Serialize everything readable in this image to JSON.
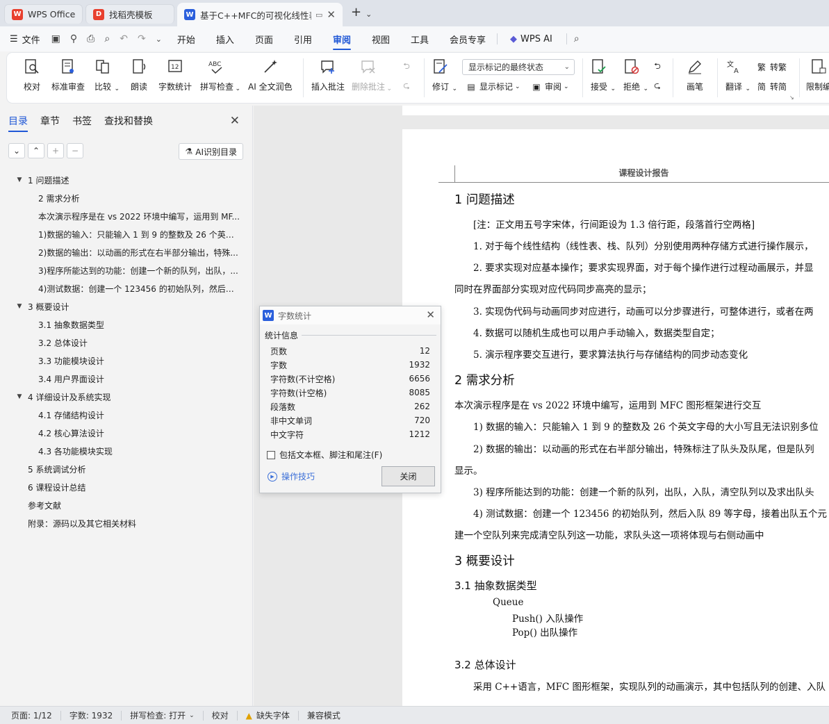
{
  "tabs": [
    {
      "label": "WPS Office",
      "state": "inactive",
      "color": "#e8402f"
    },
    {
      "label": "找稻壳模板",
      "state": "inactive",
      "color": "#e8402f"
    },
    {
      "label": "基于C++MFC的可视化线性表",
      "state": "active",
      "color": "#2b5fdc"
    }
  ],
  "menu": {
    "file": "文件",
    "items": [
      "开始",
      "插入",
      "页面",
      "引用",
      "审阅",
      "视图",
      "工具",
      "会员专享"
    ],
    "active": "审阅",
    "wps_ai": "WPS AI"
  },
  "ribbon": {
    "proofread": "校对",
    "standard_review": "标准审查",
    "compare": "比较",
    "read_aloud": "朗读",
    "word_count": "字数统计",
    "spell_check": "拼写检查",
    "ai_polish": "AI 全文润色",
    "insert_comment": "插入批注",
    "delete_comment": "删除批注",
    "revise": "修订",
    "markup_mode": "显示标记的最终状态",
    "show_markup": "显示标记",
    "review": "审阅",
    "accept": "接受",
    "reject": "拒绝",
    "pen": "画笔",
    "translate": "翻译",
    "to_traditional": "转繁",
    "to_simplified": "转简",
    "restrict": "限制编"
  },
  "nav": {
    "tabs": [
      "目录",
      "章节",
      "书签",
      "查找和替换"
    ],
    "active_tab": "目录",
    "ai_button": "AI识别目录",
    "toc": [
      {
        "level": 1,
        "text": "1  问题描述",
        "expanded": true
      },
      {
        "level": 2,
        "text": "2  需求分析"
      },
      {
        "level": 2,
        "text": "本次演示程序是在 vs 2022 环境中编写，运用到 MF..."
      },
      {
        "level": 2,
        "text": "1)数据的输入：只能输入 1 到 9 的整数及 26 个英文..."
      },
      {
        "level": 2,
        "text": "2)数据的输出：以动画的形式在右半部分输出，特殊..."
      },
      {
        "level": 2,
        "text": "3)程序所能达到的功能：创建一个新的队列，出队，..."
      },
      {
        "level": 2,
        "text": "4)测试数据：创建一个 123456 的初始队列，然后入..."
      },
      {
        "level": 1,
        "text": "3  概要设计",
        "expanded": true
      },
      {
        "level": 2,
        "text": "3.1 抽象数据类型"
      },
      {
        "level": 2,
        "text": "3.2  总体设计"
      },
      {
        "level": 2,
        "text": "3.3  功能模块设计"
      },
      {
        "level": 2,
        "text": "3.4  用户界面设计"
      },
      {
        "level": 1,
        "text": "4  详细设计及系统实现",
        "expanded": true
      },
      {
        "level": 2,
        "text": "4.1  存储结构设计"
      },
      {
        "level": 2,
        "text": "4.2  核心算法设计"
      },
      {
        "level": 2,
        "text": "4.3  各功能模块实现"
      },
      {
        "level": 1,
        "text": "5  系统调试分析",
        "leaf": true
      },
      {
        "level": 1,
        "text": "6  课程设计总结",
        "leaf": true
      },
      {
        "level": 1,
        "text": "参考文献",
        "leaf": true
      },
      {
        "level": 1,
        "text": "附录：源码以及其它相关材料",
        "leaf": true
      }
    ]
  },
  "document": {
    "header": "课程设计报告",
    "lines": [
      {
        "cls": "h1",
        "text": "1  问题描述"
      },
      {
        "cls": "",
        "text": "[注：正文用五号字宋体，行间距设为 1.3 倍行距，段落首行空两格]"
      },
      {
        "cls": "",
        "text": "1.     对于每个线性结构（线性表、栈、队列）分别使用两种存储方式进行操作展示，"
      },
      {
        "cls": "",
        "text": "2.     要求实现对应基本操作；要求实现界面，对于每个操作进行过程动画展示，并显"
      },
      {
        "cls": "",
        "text": "同时在界面部分实现对应代码同步高亮的显示；"
      },
      {
        "cls": "",
        "text": "3.     实现伪代码与动画同步对应进行，动画可以分步骤进行，可整体进行，或者在两"
      },
      {
        "cls": "",
        "text": "4.     数据可以随机生成也可以用户手动输入，数据类型自定；"
      },
      {
        "cls": "",
        "text": "5.     演示程序要交互进行，要求算法执行与存储结构的同步动态变化"
      },
      {
        "cls": "h1",
        "text": "2  需求分析"
      },
      {
        "cls": "",
        "text": "本次演示程序是在 vs 2022 环境中编写，运用到 MFC 图形框架进行交互"
      },
      {
        "cls": "",
        "text": "1)     数据的输入：只能输入 1 到 9 的整数及 26 个英文字母的大小写且无法识别多位"
      },
      {
        "cls": "",
        "text": "2)     数据的输出：以动画的形式在右半部分输出，特殊标注了队头及队尾，但是队列"
      },
      {
        "cls": "",
        "text": "显示。"
      },
      {
        "cls": "",
        "text": "3)     程序所能达到的功能：创建一个新的队列，出队，入队，清空队列以及求出队头"
      },
      {
        "cls": "",
        "text": "4)     测试数据：创建一个 123456 的初始队列，然后入队 89 等字母，接着出队五个元"
      },
      {
        "cls": "",
        "text": "建一个空队列来完成清空队列这一功能，求队头这一项将体现与右侧动画中"
      },
      {
        "cls": "h1",
        "text": "3  概要设计"
      },
      {
        "cls": "h2",
        "text": "3.1 抽象数据类型"
      },
      {
        "cls": "",
        "text": "Queue"
      },
      {
        "cls": "",
        "text": "Push() 入队操作"
      },
      {
        "cls": "",
        "text": "Pop() 出队操作"
      },
      {
        "cls": "h2",
        "text": "3.2  总体设计"
      },
      {
        "cls": "",
        "text": "采用 C++语言，MFC 图形框架，实现队列的动画演示，其中包括队列的创建、入队"
      }
    ]
  },
  "dialog": {
    "title": "字数统计",
    "group": "统计信息",
    "rows": [
      {
        "label": "页数",
        "value": "12"
      },
      {
        "label": "字数",
        "value": "1932"
      },
      {
        "label": "字符数(不计空格)",
        "value": "6656"
      },
      {
        "label": "字符数(计空格)",
        "value": "8085"
      },
      {
        "label": "段落数",
        "value": "262"
      },
      {
        "label": "非中文单词",
        "value": "720"
      },
      {
        "label": "中文字符",
        "value": "1212"
      }
    ],
    "checkbox": "包括文本框、脚注和尾注(F)",
    "tips": "操作技巧",
    "close": "关闭"
  },
  "status": {
    "page": "页面: 1/12",
    "words": "字数: 1932",
    "spell": "拼写检查: 打开",
    "proof": "校对",
    "missing_font": "缺失字体",
    "compat": "兼容模式"
  }
}
